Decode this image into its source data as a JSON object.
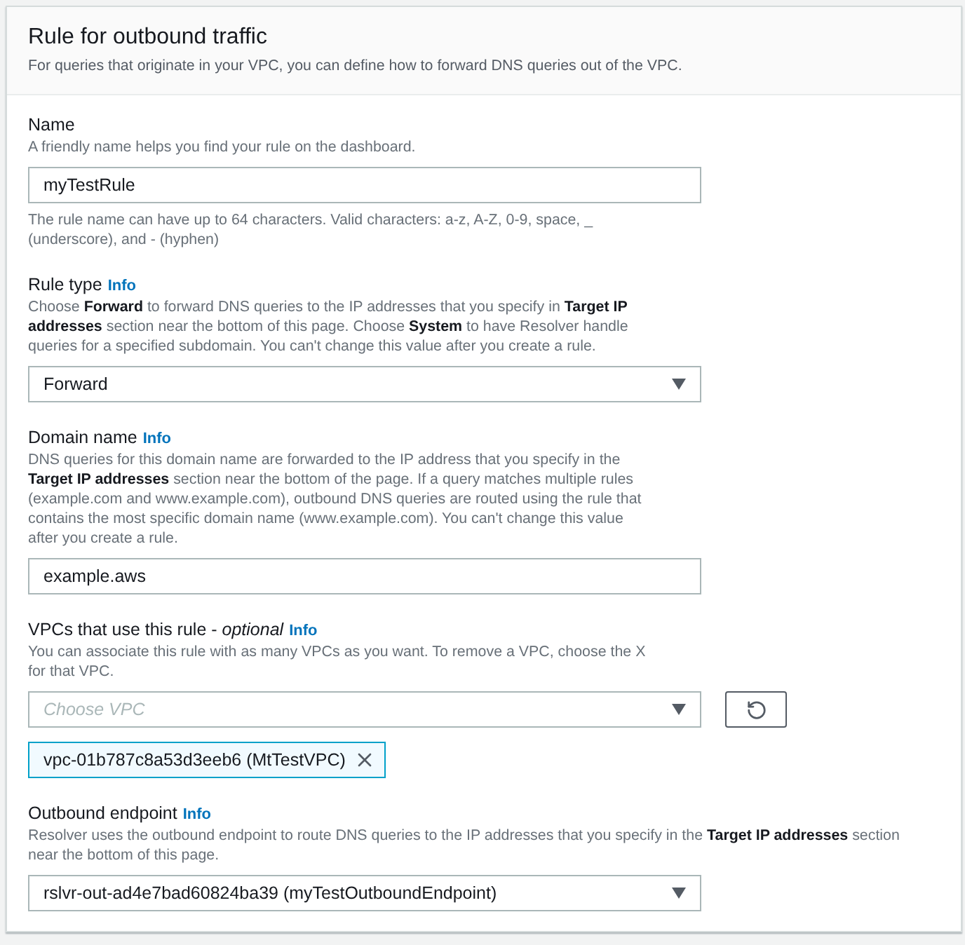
{
  "panel": {
    "title": "Rule for outbound traffic",
    "description": "For queries that originate in your VPC, you can define how to forward DNS queries out of the VPC."
  },
  "fields": [
    {
      "kind": "text",
      "label": "Name",
      "description": [
        "A friendly name helps you find your rule on the dashboard."
      ],
      "value": "myTestRule",
      "constraint": [
        "The rule name can have up to 64 characters. Valid characters: a-z, A-Z, 0-9, space, _",
        "(underscore), and - (hyphen)"
      ]
    },
    {
      "kind": "select",
      "label": "Rule type",
      "info": "Info",
      "description": [
        "Choose **Forward** to forward DNS queries to the IP addresses that you specify in **Target IP**",
        "**addresses** section near the bottom of this page. Choose **System** to have Resolver handle",
        "queries for a specified subdomain. You can't change this value after you create a rule."
      ],
      "value": "Forward"
    },
    {
      "kind": "text",
      "label": "Domain name",
      "info": "Info",
      "description": [
        "DNS queries for this domain name are forwarded to the IP address that you specify in the",
        "**Target IP addresses** section near the bottom of the page. If a query matches multiple rules",
        "(example.com and www.example.com), outbound DNS queries are routed using the rule that",
        "contains the most specific domain name (www.example.com). You can't change this value",
        "after you create a rule."
      ],
      "value": "example.aws"
    },
    {
      "kind": "multiselect",
      "label": "VPCs that use this rule - *optional*",
      "info": "Info",
      "description": [
        "You can associate this rule with as many VPCs as you want. To remove a VPC, choose the X",
        "for that VPC."
      ],
      "placeholder": "Choose VPC",
      "chips": [
        "vpc-01b787c8a53d3eeb6 (MtTestVPC)"
      ]
    },
    {
      "kind": "select",
      "label": "Outbound endpoint",
      "info": "Info",
      "description": [
        "Resolver uses the outbound endpoint to route DNS queries to the IP addresses that you specify in the **Target IP addresses** section",
        "near the bottom of this page."
      ],
      "value": "rslvr-out-ad4e7bad60824ba39 (myTestOutboundEndpoint)"
    }
  ]
}
